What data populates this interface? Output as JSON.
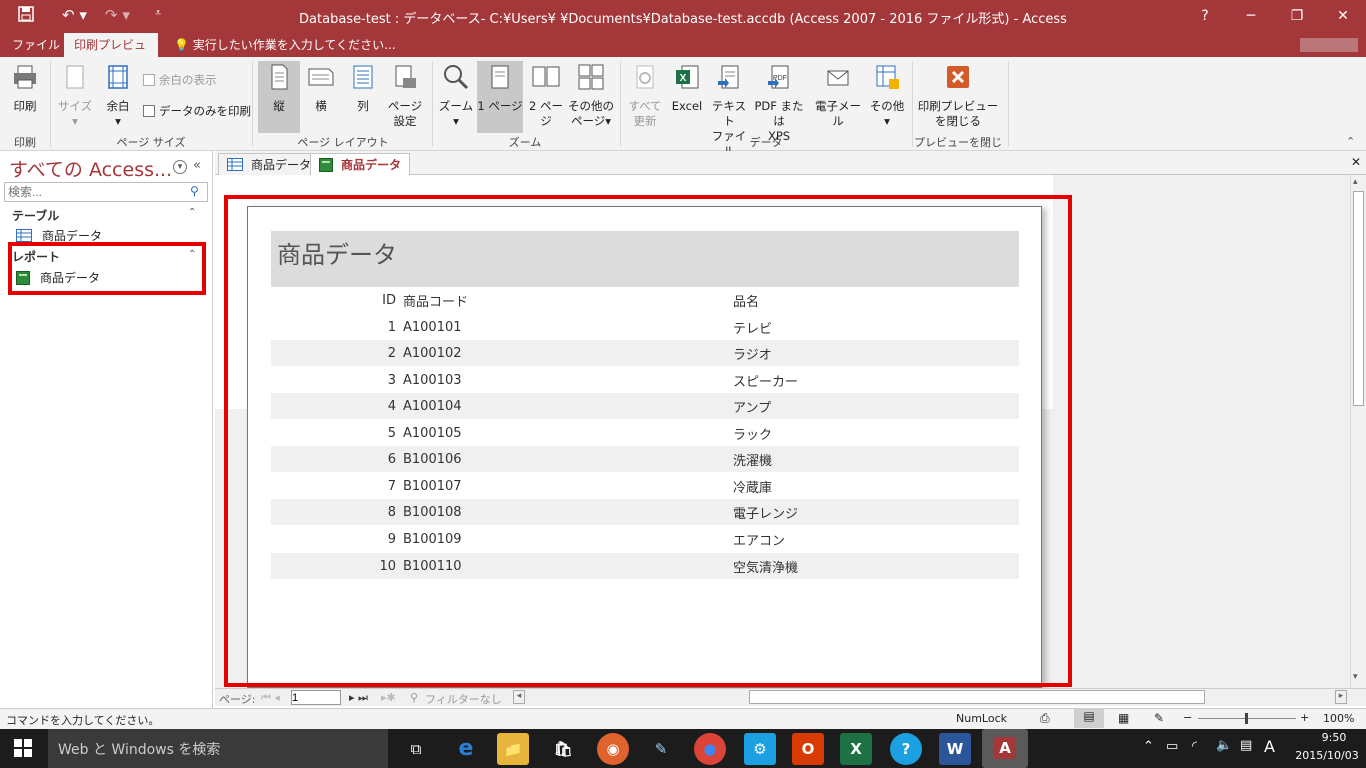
{
  "window": {
    "title": "Database-test : データベース- C:¥Users¥    ¥Documents¥Database-test.accdb (Access 2007 - 2016 ファイル形式) - Access",
    "controls": {
      "help": "?",
      "minimize": "─",
      "restore": "❐",
      "close": "✕"
    }
  },
  "ribbon_tabs": {
    "file": "ファイル",
    "print_preview": "印刷プレビュー",
    "tell_me": "実行したい作業を入力してください..."
  },
  "ribbon": {
    "print": {
      "btn": "印刷",
      "group": "印刷"
    },
    "page_size": {
      "size": "サイズ",
      "margins": "余白",
      "show_margins": "余白の表示",
      "data_only": "データのみを印刷",
      "group": "ページ サイズ"
    },
    "layout": {
      "portrait": "縦",
      "landscape": "横",
      "columns": "列",
      "page_setup_1": "ページ",
      "page_setup_2": "設定",
      "group": "ページ レイアウト"
    },
    "zoom": {
      "zoom": "ズーム",
      "one_page": "1 ページ",
      "two_pages": "2 ページ",
      "more_1": "その他の",
      "more_2": "ページ",
      "group": "ズーム"
    },
    "data": {
      "refresh_1": "すべて",
      "refresh_2": "更新",
      "excel": "Excel",
      "text_1": "テキスト",
      "text_2": "ファイル",
      "pdf_1": "PDF または",
      "pdf_2": "XPS",
      "email": "電子メール",
      "more": "その他",
      "group": "データ"
    },
    "close": {
      "btn_1": "印刷プレビュー",
      "btn_2": "を閉じる",
      "group": "プレビューを閉じる"
    }
  },
  "nav": {
    "title": "すべての Access...",
    "search_placeholder": "検索...",
    "tables_section": "テーブル",
    "table_item": "商品データ",
    "reports_section": "レポート",
    "report_item": "商品データ"
  },
  "doc_tabs": [
    {
      "label": "商品データ"
    },
    {
      "label": "商品データ"
    }
  ],
  "report": {
    "title": "商品データ",
    "headers": {
      "id": "ID",
      "code": "商品コード",
      "name": "品名"
    },
    "rows": [
      {
        "id": "1",
        "code": "A100101",
        "name": "テレビ"
      },
      {
        "id": "2",
        "code": "A100102",
        "name": "ラジオ"
      },
      {
        "id": "3",
        "code": "A100103",
        "name": "スピーカー"
      },
      {
        "id": "4",
        "code": "A100104",
        "name": "アンプ"
      },
      {
        "id": "5",
        "code": "A100105",
        "name": "ラック"
      },
      {
        "id": "6",
        "code": "B100106",
        "name": "洗濯機"
      },
      {
        "id": "7",
        "code": "B100107",
        "name": "冷蔵庫"
      },
      {
        "id": "8",
        "code": "B100108",
        "name": "電子レンジ"
      },
      {
        "id": "9",
        "code": "B100109",
        "name": "エアコン"
      },
      {
        "id": "10",
        "code": "B100110",
        "name": "空気清浄機"
      }
    ]
  },
  "record_nav": {
    "label": "ページ:",
    "page": "1",
    "filter": "フィルターなし"
  },
  "status": {
    "left": "コマンドを入力してください。",
    "numlock": "NumLock",
    "zoom": "100%"
  },
  "taskbar": {
    "search": "Web と Windows を検索",
    "time": "9:50",
    "date": "2015/10/03",
    "ime": "A"
  },
  "colors": {
    "accent": "#a4373a",
    "highlight_red": "#e60000"
  }
}
